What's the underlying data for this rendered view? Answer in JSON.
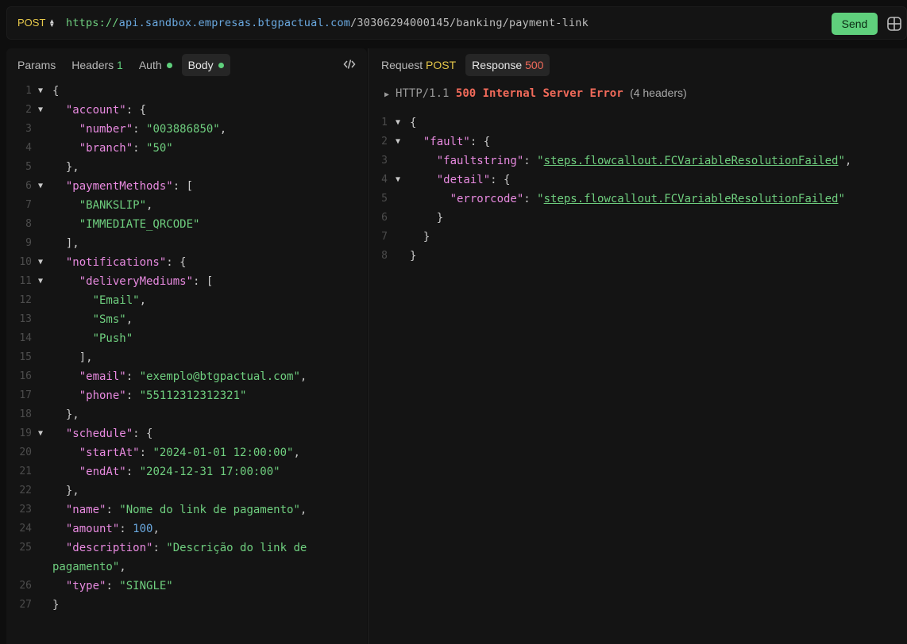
{
  "request": {
    "method": "POST",
    "url_protocol": "https://",
    "url_host": "api.sandbox.empresas.btgpactual.com",
    "url_path": "/30306294000145/banking/payment-link",
    "send_label": "Send"
  },
  "left_tabs": {
    "params": "Params",
    "headers": "Headers",
    "headers_count": "1",
    "auth": "Auth",
    "body": "Body"
  },
  "right_tabs": {
    "request_label": "Request",
    "request_method": "POST",
    "response_label": "Response",
    "response_status": "500"
  },
  "response_status_line": {
    "version": "HTTP/1.1",
    "status": "500 Internal Server Error",
    "headers": "(4 headers)"
  },
  "body_lines": [
    "1",
    "2",
    "3",
    "4",
    "5",
    "6",
    "7",
    "8",
    "9",
    "10",
    "11",
    "12",
    "13",
    "14",
    "15",
    "16",
    "17",
    "18",
    "19",
    "20",
    "21",
    "22",
    "23",
    "24",
    "25",
    "26",
    "27"
  ],
  "body": {
    "account_key": "\"account\"",
    "number_key": "\"number\"",
    "number_val": "\"003886850\"",
    "branch_key": "\"branch\"",
    "branch_val": "\"50\"",
    "paymentMethods_key": "\"paymentMethods\"",
    "pm_1": "\"BANKSLIP\"",
    "pm_2": "\"IMMEDIATE_QRCODE\"",
    "notifications_key": "\"notifications\"",
    "deliveryMediums_key": "\"deliveryMediums\"",
    "dm_1": "\"Email\"",
    "dm_2": "\"Sms\"",
    "dm_3": "\"Push\"",
    "email_key": "\"email\"",
    "email_val": "\"exemplo@btgpactual.com\"",
    "phone_key": "\"phone\"",
    "phone_val": "\"55112312312321\"",
    "schedule_key": "\"schedule\"",
    "startAt_key": "\"startAt\"",
    "startAt_val": "\"2024-01-01 12:00:00\"",
    "endAt_key": "\"endAt\"",
    "endAt_val": "\"2024-12-31 17:00:00\"",
    "name_key": "\"name\"",
    "name_val": "\"Nome do link de pagamento\"",
    "amount_key": "\"amount\"",
    "amount_val": "100",
    "description_key": "\"description\"",
    "description_val_1": "\"Descrição do link de",
    "description_val_2": "pagamento\"",
    "type_key": "\"type\"",
    "type_val": "\"SINGLE\""
  },
  "response_lines": [
    "1",
    "2",
    "3",
    "4",
    "5",
    "6",
    "7",
    "8"
  ],
  "response": {
    "fault_key": "\"fault\"",
    "faultstring_key": "\"faultstring\"",
    "faultstring_val": "steps.flowcallout.FCVariableResolutionFailed",
    "detail_key": "\"detail\"",
    "errorcode_key": "\"errorcode\"",
    "errorcode_val": "steps.flowcallout.FCVariableResolutionFailed"
  }
}
